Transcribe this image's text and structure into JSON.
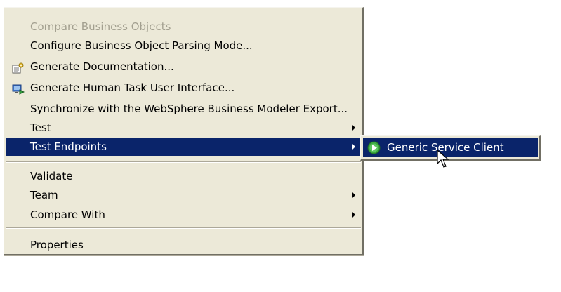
{
  "context_menu": {
    "items": [
      {
        "label": "Compare Business Objects",
        "disabled": true
      },
      {
        "label": "Configure Business Object Parsing Mode..."
      },
      {
        "label": "Generate Documentation...",
        "icon": "document-gear-icon"
      },
      {
        "label": "Generate Human Task User Interface...",
        "icon": "monitor-arrow-icon"
      },
      {
        "label": "Synchronize with the WebSphere Business Modeler Export..."
      },
      {
        "label": "Test",
        "has_submenu": true
      },
      {
        "label": "Test Endpoints",
        "has_submenu": true,
        "selected": true
      },
      {
        "label": "Validate"
      },
      {
        "label": "Team",
        "has_submenu": true
      },
      {
        "label": "Compare With",
        "has_submenu": true
      },
      {
        "label": "Properties"
      }
    ]
  },
  "submenu": {
    "items": [
      {
        "label": "Generic Service Client",
        "icon": "green-play-icon",
        "selected": true
      }
    ]
  },
  "colors": {
    "menu_background": "#ece9d8",
    "selection": "#0a246a",
    "disabled_text": "#a29f8f"
  }
}
